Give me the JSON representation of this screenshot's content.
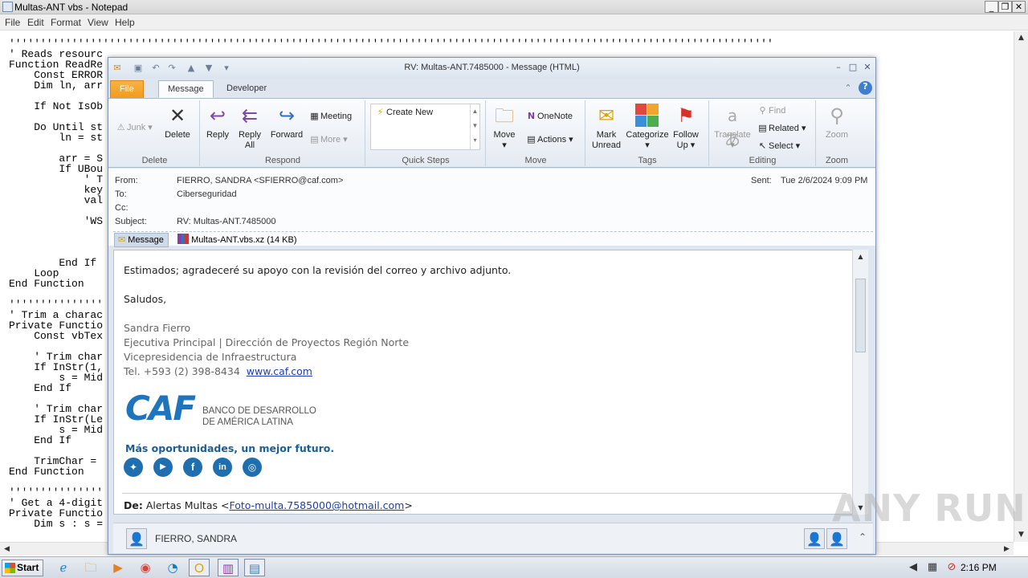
{
  "notepad": {
    "title": "Multas-ANT vbs - Notepad",
    "menu": [
      "File",
      "Edit",
      "Format",
      "View",
      "Help"
    ],
    "lines": [
      "''''''''''''''''''''''''''''''''''''''''''''''''''''''''''''''''''''''''''''''''''''''''''''''''''''''''''''''''''''''''''",
      "' Reads resourc",
      "Function ReadRe",
      "    Const ERROR",
      "    Dim ln, arr",
      "",
      "    If Not IsOb",
      "",
      "    Do Until st",
      "        ln = st",
      "",
      "        arr = S",
      "        If UBou",
      "            ' T",
      "            key",
      "            val",
      "",
      "            'WS",
      "",
      "",
      "",
      "        End If",
      "    Loop",
      "End Function",
      "",
      "'''''''''''''''",
      "' Trim a charac",
      "Private Functio",
      "    Const vbTex",
      "",
      "    ' Trim char",
      "    If InStr(1,",
      "        s = Mid",
      "    End If",
      "",
      "    ' Trim char",
      "    If InStr(Le",
      "        s = Mid",
      "    End If",
      "",
      "    TrimChar =",
      "End Function",
      "",
      "'''''''''''''''",
      "' Get a 4-digit",
      "Private Functio",
      "    Dim s : s ="
    ]
  },
  "outlook": {
    "title": "RV: Multas-ANT.7485000  -  Message (HTML)",
    "tabs": [
      "File",
      "Message",
      "Developer"
    ],
    "ribbon": {
      "delete_group": "Delete",
      "junk": "Junk",
      "delete": "Delete",
      "respond_group": "Respond",
      "reply": "Reply",
      "reply_all_1": "Reply",
      "reply_all_2": "All",
      "forward": "Forward",
      "meeting": "Meeting",
      "more": "More",
      "quicksteps_group": "Quick Steps",
      "create_new": "Create New",
      "move_group": "Move",
      "move": "Move",
      "onenote": "OneNote",
      "actions": "Actions",
      "tags_group": "Tags",
      "mark_unread_1": "Mark",
      "mark_unread_2": "Unread",
      "categorize": "Categorize",
      "follow_up_1": "Follow",
      "follow_up_2": "Up",
      "editing_group": "Editing",
      "translate": "Translate",
      "find": "Find",
      "related": "Related",
      "select": "Select",
      "zoom_group": "Zoom",
      "zoom": "Zoom"
    },
    "headers": {
      "from_label": "From:",
      "from": "FIERRO, SANDRA <SFIERRO@caf.com>",
      "to_label": "To:",
      "to": "Ciberseguridad",
      "cc_label": "Cc:",
      "subject_label": "Subject:",
      "subject": "RV: Multas-ANT.7485000",
      "sent_label": "Sent:",
      "sent": "Tue 2/6/2024 9:09 PM"
    },
    "attachments": {
      "message_tab": "Message",
      "file": "Multas-ANT.vbs.xz (14 KB)"
    },
    "body": {
      "line1": "Estimados; agradeceré su apoyo con la revisión del correo y archivo adjunto.",
      "line2": "Saludos,",
      "sig_name": "Sandra Fierro",
      "sig_title": "Ejecutiva Principal | Dirección de Proyectos Región Norte",
      "sig_dept": "Vicepresidencia de Infraestructura",
      "sig_phone": "Tel. +593 (2) 398-8434",
      "sig_web": "www.caf.com",
      "logo_text": "CAF",
      "logo_line1": "BANCO DE DESARROLLO",
      "logo_line2": "DE AMÉRICA LATINA",
      "slogan": "Más oportunidades, un mejor futuro.",
      "de_label": "De:",
      "de_name": "Alertas Multas <",
      "de_email": "Foto-multa.7585000@hotmail.com",
      "de_close": ">"
    },
    "people": {
      "name": "FIERRO, SANDRA"
    }
  },
  "taskbar": {
    "start": "Start",
    "clock": "2:16 PM"
  },
  "watermark": "ANY RUN"
}
